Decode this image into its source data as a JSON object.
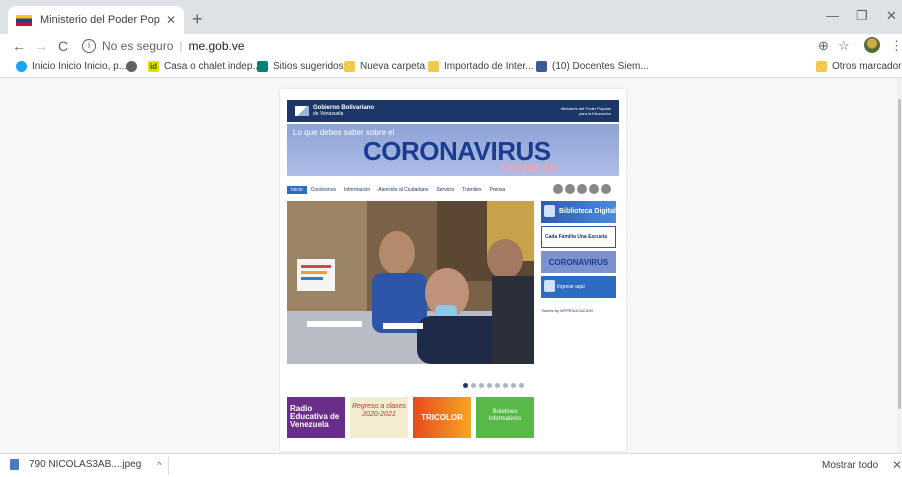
{
  "browser": {
    "tab_title": "Ministerio del Poder Popular Par",
    "tab_close": "✕",
    "new_tab": "+",
    "window_min": "—",
    "window_restore": "❐",
    "window_close": "✕",
    "back": "←",
    "forward": "→",
    "reload": "C",
    "info": "i",
    "security_text": "No es seguro",
    "separator": "|",
    "url": "me.gob.ve",
    "zoom_icon": "⊕",
    "star_icon": "☆",
    "menu_icon": "⋮"
  },
  "bookmarks": [
    {
      "label": "Inicio Inicio Inicio, p...",
      "icon": "twitter-icon"
    },
    {
      "label": "",
      "icon": "globe-icon"
    },
    {
      "label": "Casa o chalet indep...",
      "icon": "idealista-icon",
      "badge": "id"
    },
    {
      "label": "Sitios sugeridos",
      "icon": "bing-icon"
    },
    {
      "label": "Nueva carpeta",
      "icon": "folder-icon"
    },
    {
      "label": "Importado de Inter...",
      "icon": "folder-icon"
    },
    {
      "label": "(10) Docentes Siem...",
      "icon": "facebook-icon"
    }
  ],
  "other_bookmarks": "Otros marcadores",
  "site": {
    "gov_logo_line1": "Gobierno Bolivariano",
    "gov_logo_line2": "de Venezuela",
    "ministry_line1": "Ministerio del Poder Popular",
    "ministry_line2": "para la Educación",
    "covid_lead": "Lo que debes saber sobre el",
    "covid_word": "CORONAVIRUS",
    "covid_sub": "COVID-19",
    "nav": [
      "Inicio",
      "Conócenos",
      "Información",
      "Atención al Ciudadano",
      "Servicio",
      "Trámites",
      "Prensa"
    ],
    "side_banners": {
      "biblioteca": "Biblioteca Digital",
      "cada_familia": "Cada Familia Una Escuela",
      "coronavirus": "CORONAVIRUS",
      "ingrese": "Ingrese aquí"
    },
    "tweets_link": "Tweets by MPPEDUCACION",
    "bottom_banners": {
      "radio": "Radio Educativa de Venezuela",
      "regreso": "Regreso a clases 2020-2021",
      "tricolor": "TRICOLOR",
      "boletines": "Boletines Informativos"
    }
  },
  "download": {
    "filename": "790 NICOLAS3AB....jpeg",
    "chevron": "^",
    "show_all": "Mostrar todo",
    "close": "✕"
  }
}
